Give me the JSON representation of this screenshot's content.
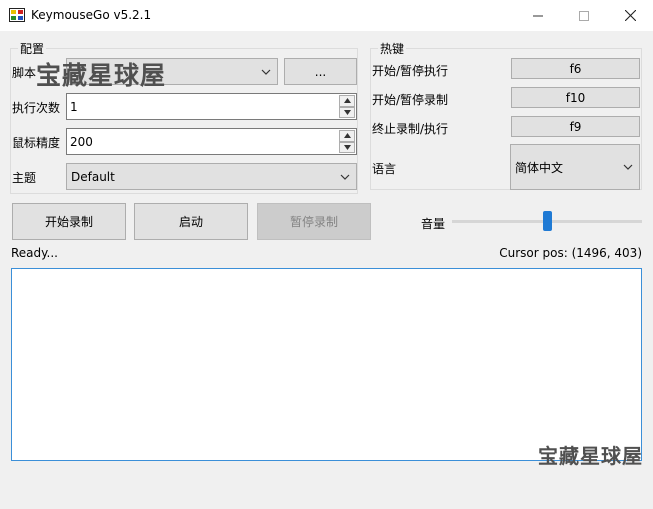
{
  "window": {
    "title": "KeymouseGo v5.2.1",
    "controls": {
      "minimize": "—",
      "maximize": "☐",
      "close": "✕"
    }
  },
  "config": {
    "group_title": "配置",
    "script_label": "脚本",
    "script_value": "",
    "browse_label": "...",
    "run_times_label": "执行次数",
    "run_times_value": "1",
    "mouse_precision_label": "鼠标精度",
    "mouse_precision_value": "200",
    "theme_label": "主题",
    "theme_value": "Default"
  },
  "hotkeys": {
    "group_title": "热键",
    "start_exec_label": "开始/暂停执行",
    "start_exec_key": "f6",
    "start_record_label": "开始/暂停录制",
    "start_record_key": "f10",
    "stop_label": "终止录制/执行",
    "stop_key": "f9",
    "language_label": "语言",
    "language_value": "简体中文"
  },
  "actions": {
    "start_record": "开始录制",
    "launch": "启动",
    "pause_record": "暂停录制"
  },
  "volume": {
    "label": "音量",
    "level": 0.5
  },
  "status": {
    "text": "Ready...",
    "cursor": "Cursor pos: (1496, 403)"
  },
  "watermark": {
    "text": "宝藏星球屋"
  },
  "colors": {
    "accent": "#1f7ad4",
    "log_border": "#3b8fd8"
  }
}
